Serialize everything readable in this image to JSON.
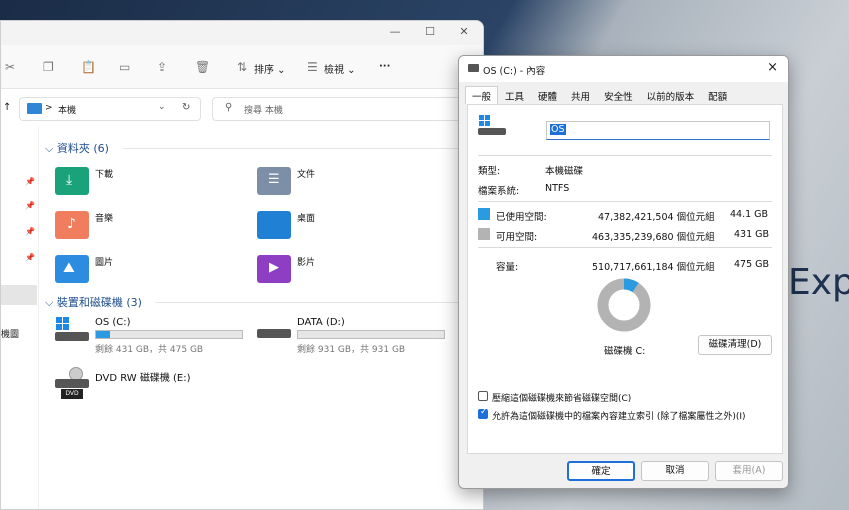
{
  "desktop": {
    "partial_text": "Exp"
  },
  "explorer": {
    "toolbar": {
      "sort_label": "排序",
      "view_label": "檢視",
      "more": "···"
    },
    "address": {
      "path": "本機",
      "arrow": ">"
    },
    "search": {
      "placeholder": "搜尋 本機"
    },
    "folders_group": "資料夾 (6)",
    "folders": [
      {
        "name": "下載"
      },
      {
        "name": "文件"
      },
      {
        "name": "音樂"
      },
      {
        "name": "桌面"
      },
      {
        "name": "圖片"
      },
      {
        "name": "影片"
      }
    ],
    "drives_group": "裝置和磁碟機 (3)",
    "drives": [
      {
        "name": "OS (C:)",
        "free": "剩餘 431 GB，共 475 GB",
        "used_fraction": 0.093
      },
      {
        "name": "DATA (D:)",
        "free": "剩餘 931 GB，共 931 GB",
        "used_fraction": 0.0
      },
      {
        "name": "DVD RW 磁碟機 (E:)",
        "badge": "DVD"
      }
    ],
    "nav_partial": "機圖"
  },
  "dialog": {
    "title": "OS (C:) - 內容",
    "close": "×",
    "tabs": [
      "一般",
      "工具",
      "硬體",
      "共用",
      "安全性",
      "以前的版本",
      "配額"
    ],
    "drive_label": "OS",
    "type_label": "類型:",
    "type_value": "本機磁碟",
    "fs_label": "檔案系統:",
    "fs_value": "NTFS",
    "used_label": "已使用空間:",
    "used_bytes": "47,382,421,504 個位元組",
    "used_gb": "44.1 GB",
    "free_label": "可用空間:",
    "free_bytes": "463,335,239,680 個位元組",
    "free_gb": "431 GB",
    "cap_label": "容量:",
    "cap_bytes": "510,717,661,184 個位元組",
    "cap_gb": "475 GB",
    "drive_caption": "磁碟機 C:",
    "cleanup_button": "磁碟清理(D)",
    "compress_label": "壓縮這個磁碟機來節省磁碟空間(C)",
    "compress_checked": false,
    "index_label": "允許為這個磁碟機中的檔案內容建立索引 (除了檔案屬性之外)(I)",
    "index_checked": true,
    "ok": "確定",
    "cancel": "取消",
    "apply": "套用(A)",
    "used_fraction": 0.093,
    "colors": {
      "used": "#2c9ae0",
      "free": "#b3b3b3"
    }
  }
}
